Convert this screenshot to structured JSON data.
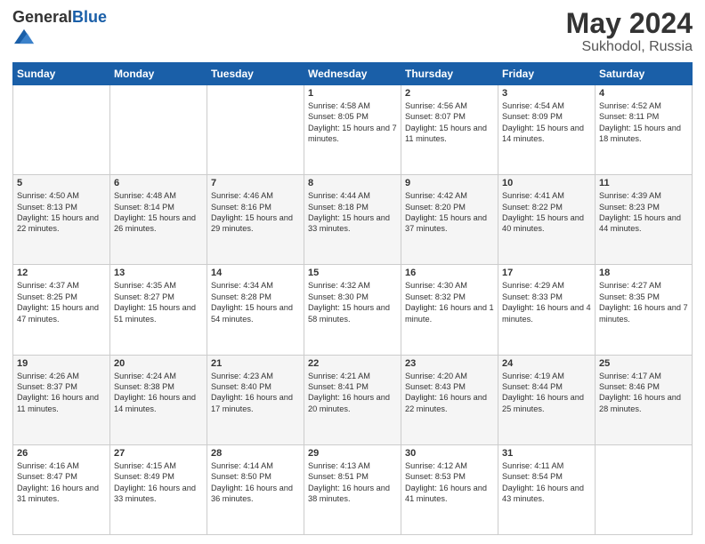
{
  "header": {
    "logo_general": "General",
    "logo_blue": "Blue",
    "title": "May 2024",
    "location": "Sukhodol, Russia"
  },
  "days_of_week": [
    "Sunday",
    "Monday",
    "Tuesday",
    "Wednesday",
    "Thursday",
    "Friday",
    "Saturday"
  ],
  "weeks": [
    {
      "days": [
        {
          "number": "",
          "sunrise": "",
          "sunset": "",
          "daylight": "",
          "empty": true
        },
        {
          "number": "",
          "sunrise": "",
          "sunset": "",
          "daylight": "",
          "empty": true
        },
        {
          "number": "",
          "sunrise": "",
          "sunset": "",
          "daylight": "",
          "empty": true
        },
        {
          "number": "1",
          "sunrise": "Sunrise: 4:58 AM",
          "sunset": "Sunset: 8:05 PM",
          "daylight": "Daylight: 15 hours and 7 minutes.",
          "empty": false
        },
        {
          "number": "2",
          "sunrise": "Sunrise: 4:56 AM",
          "sunset": "Sunset: 8:07 PM",
          "daylight": "Daylight: 15 hours and 11 minutes.",
          "empty": false
        },
        {
          "number": "3",
          "sunrise": "Sunrise: 4:54 AM",
          "sunset": "Sunset: 8:09 PM",
          "daylight": "Daylight: 15 hours and 14 minutes.",
          "empty": false
        },
        {
          "number": "4",
          "sunrise": "Sunrise: 4:52 AM",
          "sunset": "Sunset: 8:11 PM",
          "daylight": "Daylight: 15 hours and 18 minutes.",
          "empty": false
        }
      ]
    },
    {
      "days": [
        {
          "number": "5",
          "sunrise": "Sunrise: 4:50 AM",
          "sunset": "Sunset: 8:13 PM",
          "daylight": "Daylight: 15 hours and 22 minutes.",
          "empty": false
        },
        {
          "number": "6",
          "sunrise": "Sunrise: 4:48 AM",
          "sunset": "Sunset: 8:14 PM",
          "daylight": "Daylight: 15 hours and 26 minutes.",
          "empty": false
        },
        {
          "number": "7",
          "sunrise": "Sunrise: 4:46 AM",
          "sunset": "Sunset: 8:16 PM",
          "daylight": "Daylight: 15 hours and 29 minutes.",
          "empty": false
        },
        {
          "number": "8",
          "sunrise": "Sunrise: 4:44 AM",
          "sunset": "Sunset: 8:18 PM",
          "daylight": "Daylight: 15 hours and 33 minutes.",
          "empty": false
        },
        {
          "number": "9",
          "sunrise": "Sunrise: 4:42 AM",
          "sunset": "Sunset: 8:20 PM",
          "daylight": "Daylight: 15 hours and 37 minutes.",
          "empty": false
        },
        {
          "number": "10",
          "sunrise": "Sunrise: 4:41 AM",
          "sunset": "Sunset: 8:22 PM",
          "daylight": "Daylight: 15 hours and 40 minutes.",
          "empty": false
        },
        {
          "number": "11",
          "sunrise": "Sunrise: 4:39 AM",
          "sunset": "Sunset: 8:23 PM",
          "daylight": "Daylight: 15 hours and 44 minutes.",
          "empty": false
        }
      ]
    },
    {
      "days": [
        {
          "number": "12",
          "sunrise": "Sunrise: 4:37 AM",
          "sunset": "Sunset: 8:25 PM",
          "daylight": "Daylight: 15 hours and 47 minutes.",
          "empty": false
        },
        {
          "number": "13",
          "sunrise": "Sunrise: 4:35 AM",
          "sunset": "Sunset: 8:27 PM",
          "daylight": "Daylight: 15 hours and 51 minutes.",
          "empty": false
        },
        {
          "number": "14",
          "sunrise": "Sunrise: 4:34 AM",
          "sunset": "Sunset: 8:28 PM",
          "daylight": "Daylight: 15 hours and 54 minutes.",
          "empty": false
        },
        {
          "number": "15",
          "sunrise": "Sunrise: 4:32 AM",
          "sunset": "Sunset: 8:30 PM",
          "daylight": "Daylight: 15 hours and 58 minutes.",
          "empty": false
        },
        {
          "number": "16",
          "sunrise": "Sunrise: 4:30 AM",
          "sunset": "Sunset: 8:32 PM",
          "daylight": "Daylight: 16 hours and 1 minute.",
          "empty": false
        },
        {
          "number": "17",
          "sunrise": "Sunrise: 4:29 AM",
          "sunset": "Sunset: 8:33 PM",
          "daylight": "Daylight: 16 hours and 4 minutes.",
          "empty": false
        },
        {
          "number": "18",
          "sunrise": "Sunrise: 4:27 AM",
          "sunset": "Sunset: 8:35 PM",
          "daylight": "Daylight: 16 hours and 7 minutes.",
          "empty": false
        }
      ]
    },
    {
      "days": [
        {
          "number": "19",
          "sunrise": "Sunrise: 4:26 AM",
          "sunset": "Sunset: 8:37 PM",
          "daylight": "Daylight: 16 hours and 11 minutes.",
          "empty": false
        },
        {
          "number": "20",
          "sunrise": "Sunrise: 4:24 AM",
          "sunset": "Sunset: 8:38 PM",
          "daylight": "Daylight: 16 hours and 14 minutes.",
          "empty": false
        },
        {
          "number": "21",
          "sunrise": "Sunrise: 4:23 AM",
          "sunset": "Sunset: 8:40 PM",
          "daylight": "Daylight: 16 hours and 17 minutes.",
          "empty": false
        },
        {
          "number": "22",
          "sunrise": "Sunrise: 4:21 AM",
          "sunset": "Sunset: 8:41 PM",
          "daylight": "Daylight: 16 hours and 20 minutes.",
          "empty": false
        },
        {
          "number": "23",
          "sunrise": "Sunrise: 4:20 AM",
          "sunset": "Sunset: 8:43 PM",
          "daylight": "Daylight: 16 hours and 22 minutes.",
          "empty": false
        },
        {
          "number": "24",
          "sunrise": "Sunrise: 4:19 AM",
          "sunset": "Sunset: 8:44 PM",
          "daylight": "Daylight: 16 hours and 25 minutes.",
          "empty": false
        },
        {
          "number": "25",
          "sunrise": "Sunrise: 4:17 AM",
          "sunset": "Sunset: 8:46 PM",
          "daylight": "Daylight: 16 hours and 28 minutes.",
          "empty": false
        }
      ]
    },
    {
      "days": [
        {
          "number": "26",
          "sunrise": "Sunrise: 4:16 AM",
          "sunset": "Sunset: 8:47 PM",
          "daylight": "Daylight: 16 hours and 31 minutes.",
          "empty": false
        },
        {
          "number": "27",
          "sunrise": "Sunrise: 4:15 AM",
          "sunset": "Sunset: 8:49 PM",
          "daylight": "Daylight: 16 hours and 33 minutes.",
          "empty": false
        },
        {
          "number": "28",
          "sunrise": "Sunrise: 4:14 AM",
          "sunset": "Sunset: 8:50 PM",
          "daylight": "Daylight: 16 hours and 36 minutes.",
          "empty": false
        },
        {
          "number": "29",
          "sunrise": "Sunrise: 4:13 AM",
          "sunset": "Sunset: 8:51 PM",
          "daylight": "Daylight: 16 hours and 38 minutes.",
          "empty": false
        },
        {
          "number": "30",
          "sunrise": "Sunrise: 4:12 AM",
          "sunset": "Sunset: 8:53 PM",
          "daylight": "Daylight: 16 hours and 41 minutes.",
          "empty": false
        },
        {
          "number": "31",
          "sunrise": "Sunrise: 4:11 AM",
          "sunset": "Sunset: 8:54 PM",
          "daylight": "Daylight: 16 hours and 43 minutes.",
          "empty": false
        },
        {
          "number": "",
          "sunrise": "",
          "sunset": "",
          "daylight": "",
          "empty": true
        }
      ]
    }
  ]
}
